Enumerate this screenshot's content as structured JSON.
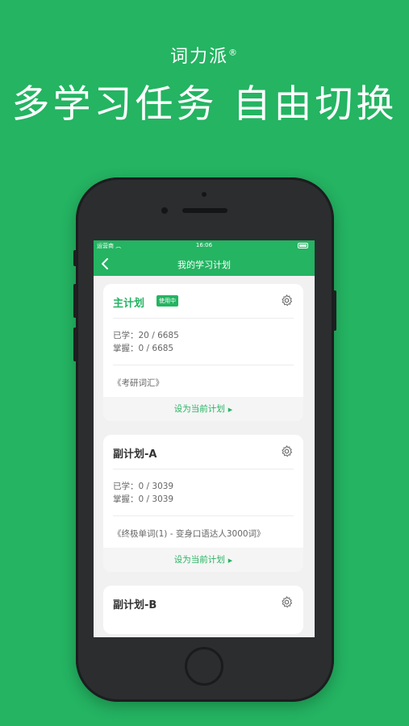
{
  "promo": {
    "brand": "词力派",
    "brand_mark": "®",
    "headline": "多学习任务 自由切换"
  },
  "status_bar": {
    "carrier": "运营商 ︵",
    "time": "16:06"
  },
  "nav": {
    "back_icon": "chevron-left",
    "title": "我的学习计划"
  },
  "plans": [
    {
      "name": "主计划",
      "badge": "使用中",
      "learned": "已学：20 / 6685",
      "mastered": "掌握：0 / 6685",
      "book": "《考研词汇》",
      "action": "设为当前计划"
    },
    {
      "name": "副计划-A",
      "learned": "已学：0 / 3039",
      "mastered": "掌握：0 / 3039",
      "book": "《终极单词(1) - 变身口语达人3000词》",
      "action": "设为当前计划"
    },
    {
      "name": "副计划-B"
    }
  ],
  "colors": {
    "brand_green": "#24b462",
    "phone_body": "#2b2d2f",
    "screen_bg": "#f1f1f1"
  }
}
